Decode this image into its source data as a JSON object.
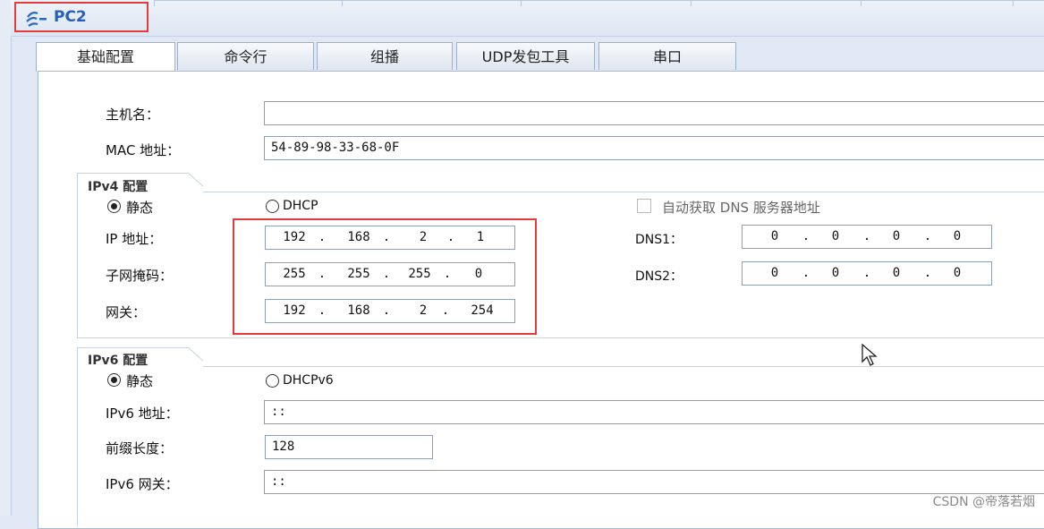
{
  "window": {
    "title": "PC2",
    "icon": "pc-terminal-icon"
  },
  "tabs": [
    {
      "label": "基础配置",
      "active": true
    },
    {
      "label": "命令行",
      "active": false
    },
    {
      "label": "组播",
      "active": false
    },
    {
      "label": "UDP发包工具",
      "active": false
    },
    {
      "label": "串口",
      "active": false
    }
  ],
  "basic": {
    "hostname_label": "主机名：",
    "hostname_value": "",
    "mac_label": "MAC 地址：",
    "mac_value": "54-89-98-33-68-0F"
  },
  "ipv4": {
    "group_title": "IPv4 配置",
    "static_label": "静态",
    "dhcp_label": "DHCP",
    "mode": "static",
    "auto_dns_label": "自动获取 DNS 服务器地址",
    "auto_dns_checked": false,
    "ip_label": "IP 地址：",
    "ip": [
      "192",
      "168",
      "2",
      "1"
    ],
    "mask_label": "子网掩码：",
    "mask": [
      "255",
      "255",
      "255",
      "0"
    ],
    "gateway_label": "网关：",
    "gateway": [
      "192",
      "168",
      "2",
      "254"
    ],
    "dns1_label": "DNS1：",
    "dns1": [
      "0",
      "0",
      "0",
      "0"
    ],
    "dns2_label": "DNS2：",
    "dns2": [
      "0",
      "0",
      "0",
      "0"
    ]
  },
  "ipv6": {
    "group_title": "IPv6 配置",
    "static_label": "静态",
    "dhcp_label": "DHCPv6",
    "mode": "static",
    "addr_label": "IPv6 地址：",
    "addr_value": "::",
    "prefix_label": "前缀长度：",
    "prefix_value": "128",
    "gateway_label": "IPv6 网关：",
    "gateway_value": "::"
  },
  "watermark": "CSDN @帝落若烟",
  "colors": {
    "highlight": "#e53b3b",
    "title": "#2860b8"
  }
}
